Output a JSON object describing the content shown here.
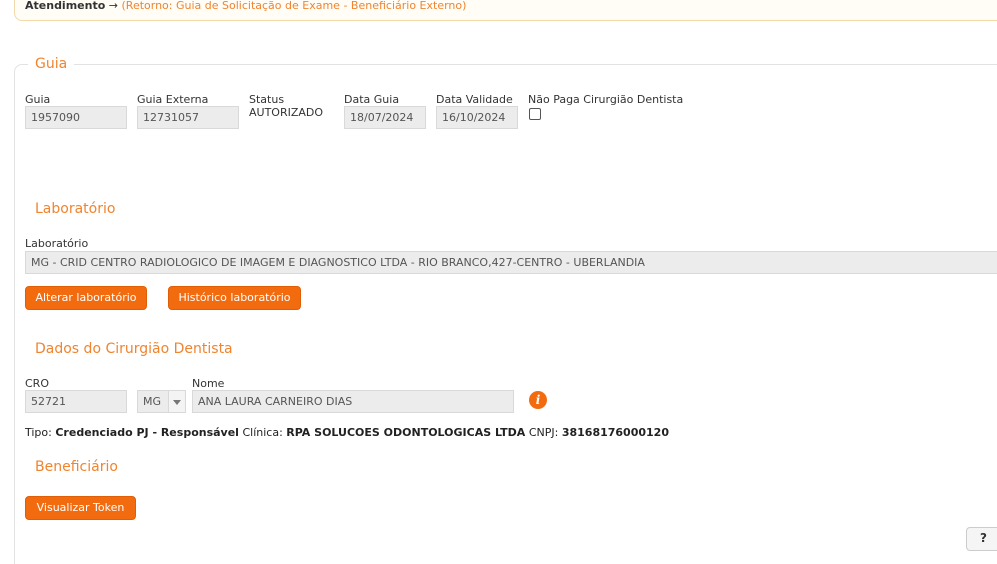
{
  "breadcrumb": {
    "root": "Atendimento",
    "arrow": "→",
    "link": "(Retorno: Guia de Solicitação de Exame - Beneficiário Externo)"
  },
  "guia": {
    "legend": "Guia",
    "guia_label": "Guia",
    "guia_value": "1957090",
    "externa_label": "Guia Externa",
    "externa_value": "12731057",
    "status_label": "Status",
    "status_value": "AUTORIZADO",
    "data_label": "Data Guia",
    "data_value": "18/07/2024",
    "validade_label": "Data Validade",
    "validade_value": "16/10/2024",
    "nao_paga_label": "Não Paga Cirurgião Dentista"
  },
  "laboratorio": {
    "title": "Laboratório",
    "label": "Laboratório",
    "value": "MG - CRID CENTRO RADIOLOGICO DE IMAGEM E DIAGNOSTICO LTDA - RIO BRANCO,427-CENTRO - UBERLANDIA",
    "alterar_button": "Alterar laboratório",
    "historico_button": "Histórico laboratório"
  },
  "dentista": {
    "title": "Dados do Cirurgião Dentista",
    "cro_label": "CRO",
    "cro_value": "52721",
    "uf_value": "MG",
    "nome_label": "Nome",
    "nome_value": "ANA LAURA CARNEIRO DIAS",
    "tipo_label": "Tipo:",
    "tipo_value": "Credenciado PJ - Responsável",
    "clinica_label": "Clínica:",
    "clinica_value": "RPA SOLUCOES ODONTOLOGICAS LTDA",
    "cnpj_label": "CNPJ:",
    "cnpj_value": "38168176000120"
  },
  "beneficiario": {
    "title": "Beneficiário",
    "token_button": "Visualizar Token"
  },
  "corner": {
    "label": "?"
  },
  "colors": {
    "accent": "#f0842f",
    "button": "#f26b0f"
  }
}
